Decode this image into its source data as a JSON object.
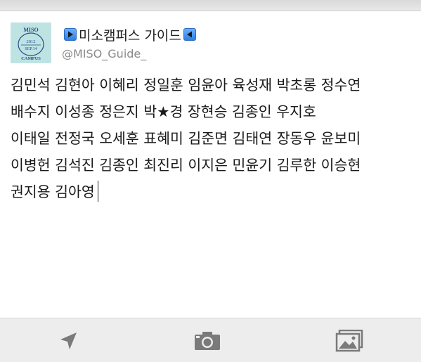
{
  "account": {
    "display_name": "미소캠퍼스 가이드",
    "handle": "@MISO_Guide_",
    "avatar": {
      "title": "MISO",
      "year": "2012",
      "date": "SEP.14",
      "subtitle": "CAMPUS"
    }
  },
  "compose": {
    "lines": [
      "김민석 김현아 이혜리 정일훈 임윤아 육성재 박초롱 정수연",
      "배수지 이성종 정은지 박★경 장현승 김종인 우지호",
      "이태일 전정국 오세훈 표혜미 김준면 김태연 장동우 윤보미",
      "이병헌 김석진 김종인 최진리 이지은 민윤기 김루한 이승현",
      "권지용 김아영"
    ]
  },
  "toolbar": {
    "icons": [
      "location-arrow-icon",
      "camera-icon",
      "gallery-icon"
    ]
  },
  "colors": {
    "avatar_bg": "#bfe3e3",
    "avatar_text": "#1f4f8a",
    "badge_blue": "#2f7fe0",
    "toolbar_bg": "#ededed",
    "icon_gray": "#7a7a7a",
    "handle_gray": "#8a8a8a"
  }
}
